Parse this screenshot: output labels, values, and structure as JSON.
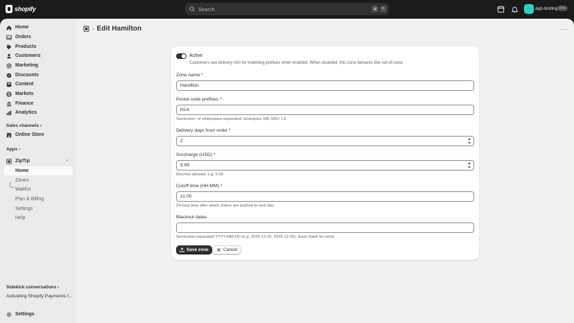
{
  "topbar": {
    "brand": "shopify",
    "search_placeholder": "Search",
    "shortcut_keys": [
      "⌘",
      "K"
    ],
    "avatar_initials": "···",
    "store_name": "app-testing",
    "env_badge": "Dev"
  },
  "sidebar": {
    "items": [
      {
        "label": "Home",
        "icon": "home-icon"
      },
      {
        "label": "Orders",
        "icon": "inbox-icon"
      },
      {
        "label": "Products",
        "icon": "tag-icon"
      },
      {
        "label": "Customers",
        "icon": "person-icon"
      },
      {
        "label": "Marketing",
        "icon": "target-icon"
      },
      {
        "label": "Discounts",
        "icon": "discount-icon"
      },
      {
        "label": "Content",
        "icon": "content-icon"
      },
      {
        "label": "Markets",
        "icon": "globe-icon"
      },
      {
        "label": "Finance",
        "icon": "bank-icon"
      },
      {
        "label": "Analytics",
        "icon": "chart-icon"
      }
    ],
    "sales_channels_label": "Sales channels",
    "online_store_label": "Online Store",
    "apps_label": "Apps",
    "app_name": "ZipTip",
    "app_subitems": [
      "Home",
      "Zones",
      "Waitlist",
      "Plan & Billing",
      "Settings",
      "Help"
    ],
    "sidekick_label": "Sidekick conversations",
    "sidekick_item": "Activating Shopify Payments f...",
    "settings_label": "Settings"
  },
  "page": {
    "title": "Edit Hamilton"
  },
  "form": {
    "active_label": "Active",
    "active_help": "Customers see delivery info for matching prefixes when enabled. When disabled, this zone behaves like out-of-zone.",
    "active_on": true,
    "zone_name_label": "Zone name *",
    "zone_name_value": "Hamilton",
    "postal_label": "Postal code prefixes *",
    "postal_value": "N1A",
    "postal_help": "Semicolon- or whitespace-separated. Examples: M5; M5V; L5",
    "delivery_label": "Delivery days from order *",
    "delivery_value": "2",
    "surcharge_label": "Surcharge (USD) *",
    "surcharge_value": "9.99",
    "surcharge_help": "Decimal allowed; e.g. 5.99",
    "cutoff_label": "Cutoff time (HH:MM) *",
    "cutoff_value": "11:00",
    "cutoff_help": "24-hour time after which orders are pushed to next day",
    "blackout_label": "Blackout dates",
    "blackout_value": "",
    "blackout_help": "Semicolon-separated YYYY-MM-DD (e.g. 2026-12-25; 2026-12-26); leave blank for none",
    "save_label": "Save zone",
    "cancel_label": "Cancel"
  }
}
